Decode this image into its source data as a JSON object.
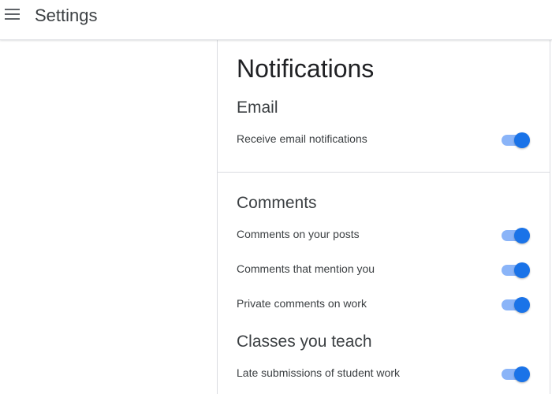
{
  "header": {
    "title": "Settings",
    "menu_icon": "hamburger-menu-icon"
  },
  "main": {
    "page_title": "Notifications",
    "sections": [
      {
        "heading": "Email",
        "items": [
          {
            "label": "Receive email notifications",
            "enabled": true
          }
        ]
      },
      {
        "heading": "Comments",
        "items": [
          {
            "label": "Comments on your posts",
            "enabled": true
          },
          {
            "label": "Comments that mention you",
            "enabled": true
          },
          {
            "label": "Private comments on work",
            "enabled": true
          }
        ]
      },
      {
        "heading": "Classes you teach",
        "items": [
          {
            "label": "Late submissions of student work",
            "enabled": true
          }
        ]
      }
    ]
  },
  "colors": {
    "toggle_thumb_on": "#1a73e8",
    "toggle_track_on": "#8ab4f8",
    "divider": "#dadce0",
    "text_primary": "#202124",
    "text_secondary": "#3c4043"
  }
}
